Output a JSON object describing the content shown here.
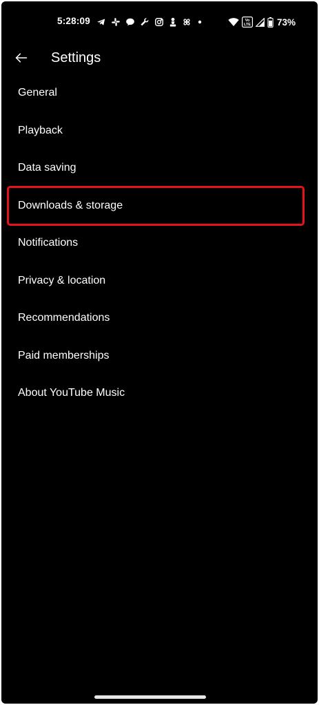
{
  "status_bar": {
    "time": "5:28:09",
    "battery_percent": "73%",
    "volte_label_top": "Vo",
    "volte_label_bottom": "LTE",
    "notification_icons": [
      "telegram-icon",
      "slack-icon",
      "chat-bubble-icon",
      "wrench-icon",
      "instagram-icon",
      "chess-pawn-icon",
      "pinwheel-icon",
      "more-notifications-dot-icon"
    ],
    "system_icons": [
      "wifi-icon",
      "volte-icon",
      "cellular-signal-icon",
      "battery-icon"
    ]
  },
  "app_bar": {
    "back_icon": "arrow-left-icon",
    "title": "Settings"
  },
  "settings_items": [
    {
      "label": "General"
    },
    {
      "label": "Playback"
    },
    {
      "label": "Data saving"
    },
    {
      "label": "Downloads & storage",
      "highlighted": true
    },
    {
      "label": "Notifications"
    },
    {
      "label": "Privacy & location"
    },
    {
      "label": "Recommendations"
    },
    {
      "label": "Paid memberships"
    },
    {
      "label": "About YouTube Music"
    }
  ],
  "colors": {
    "background": "#000000",
    "text": "#ffffff",
    "highlight_border": "#e8121b"
  }
}
